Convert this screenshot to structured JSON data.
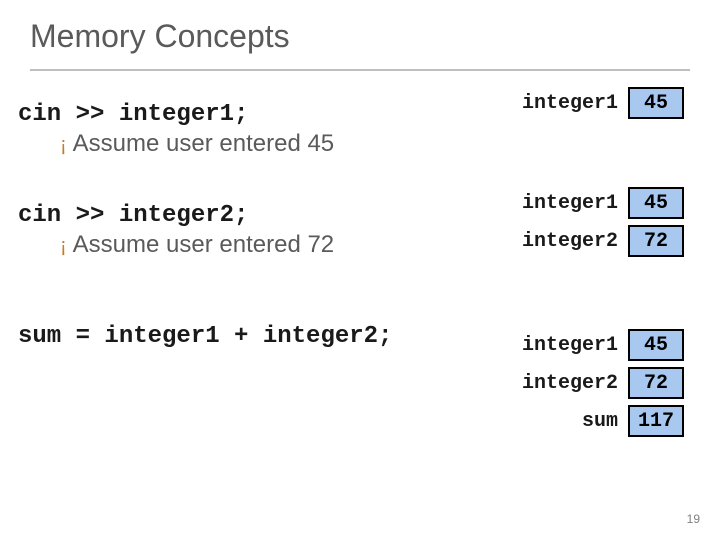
{
  "title": "Memory Concepts",
  "block1": {
    "code": "cin >> integer1;",
    "bullet": "Assume user entered 45"
  },
  "block2": {
    "code": "cin >> integer2;",
    "bullet": "Assume user entered 72"
  },
  "block3": {
    "code": "sum = integer1 + integer2;"
  },
  "mem": {
    "g1": [
      {
        "label": "integer1",
        "value": "45"
      }
    ],
    "g2": [
      {
        "label": "integer1",
        "value": "45"
      },
      {
        "label": "integer2",
        "value": "72"
      }
    ],
    "g3": [
      {
        "label": "integer1",
        "value": "45"
      },
      {
        "label": "integer2",
        "value": "72"
      },
      {
        "label": "sum",
        "value": "117"
      }
    ]
  },
  "pageNumber": "19"
}
